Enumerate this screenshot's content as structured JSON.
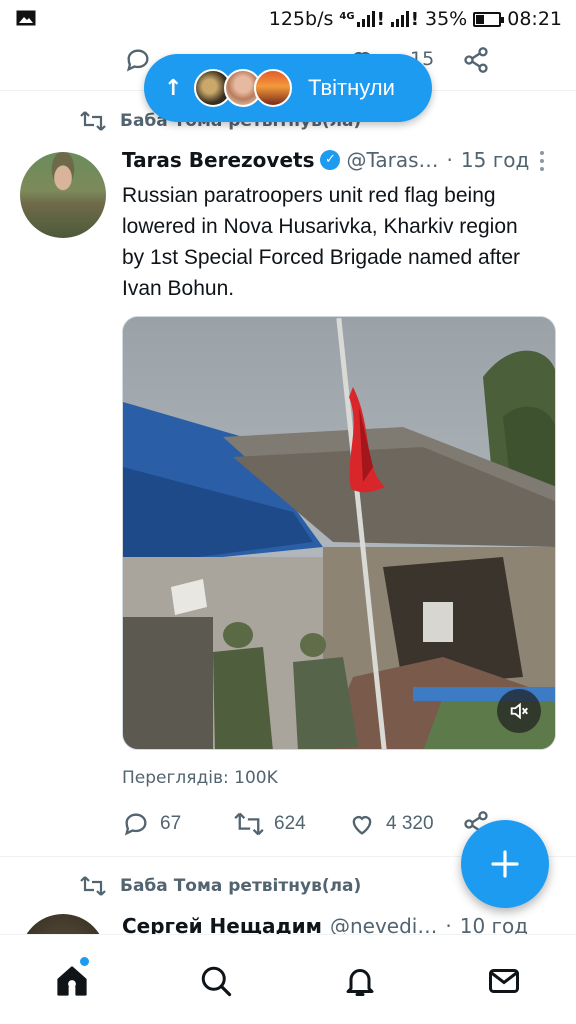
{
  "status_bar": {
    "speed": "125b/s",
    "network": "4G",
    "battery": "35%",
    "battery_level": 0.35,
    "time": "08:21"
  },
  "prev_tweet_actions": {
    "like_count": "15"
  },
  "new_tweets_pill": {
    "label": "Твітнули"
  },
  "tweet1": {
    "retweeted_by": "Баба Тома ретвітнув(ла)",
    "author_name": "Taras Berezovets",
    "handle": "@Taras…",
    "time": "15 год",
    "text": "Russian paratroopers unit red flag being lowered in Nova Husarivka, Kharkiv region by 1st Special Forced Brigade named after Ivan Bohun.",
    "views": "Переглядів: 100K",
    "replies": "67",
    "retweets": "624",
    "likes": "4 320"
  },
  "tweet2": {
    "retweeted_by": "Баба Тома ретвітнув(ла)",
    "author_name": "Сергей Нещадим",
    "handle": "@nevedi…",
    "time": "10 год"
  },
  "colors": {
    "accent": "#1d9bf0",
    "secondary_text": "#536471"
  },
  "icons": {
    "reply": "reply-icon",
    "retweet": "retweet-icon",
    "like": "heart-icon",
    "share": "share-icon",
    "compose": "plus-icon",
    "home": "home-icon",
    "search": "search-icon",
    "notifications": "bell-icon",
    "messages": "mail-icon"
  }
}
